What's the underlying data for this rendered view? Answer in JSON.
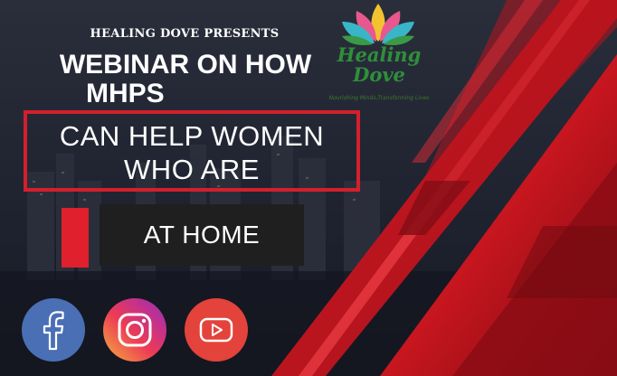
{
  "presenter": "HEALING DOVE PRESENTS",
  "headline": {
    "line1": "WEBINAR ON HOW",
    "line2": "MHPS"
  },
  "boxed": {
    "line1": "CAN HELP WOMEN",
    "line2": "WHO ARE"
  },
  "tag": "AT HOME",
  "logo": {
    "title_line1": "Healing",
    "title_line2": "Dove",
    "tagline": "Nourishing Minds,Transforming Lives"
  },
  "social_icons": [
    "facebook-icon",
    "instagram-icon",
    "youtube-icon"
  ],
  "colors": {
    "accent": "#d41f2c",
    "background": "#1a1d27",
    "facebook": "#4a6fb5",
    "youtube": "#e3433b",
    "logo_green": "#2f8f3a"
  }
}
